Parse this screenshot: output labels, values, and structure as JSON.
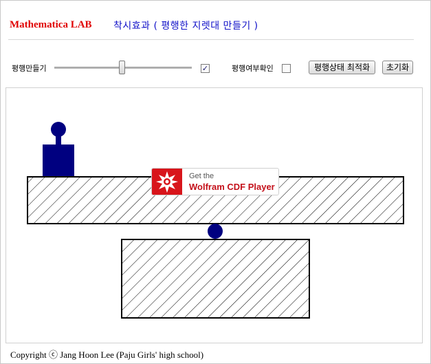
{
  "header": {
    "brand": "Mathematica LAB",
    "title": "착시효과 ( 평행한 지렛대 만들기 )"
  },
  "controls": {
    "slider_label": "평행만들기",
    "slider_value_fraction": 0.5,
    "slider_checkbox_checked": true,
    "check_label": "평행여부확인",
    "check_checked": false,
    "optimize_button": "평행상태 최적화",
    "reset_button": "초기화"
  },
  "overlay": {
    "line1": "Get the",
    "line2": "Wolfram CDF Player"
  },
  "footer": {
    "copyright": "Copyright ⓒ Jang Hoon Lee (Paju Girls' high school)"
  },
  "colors": {
    "brand": "#e00000",
    "title": "#1010c8",
    "object_fill": "#000080",
    "hatch": "#000000",
    "cdf_red": "#d8151b"
  },
  "icons": {
    "cdf_logo": "wolfram-spikey-icon",
    "check_mark": "✓"
  }
}
